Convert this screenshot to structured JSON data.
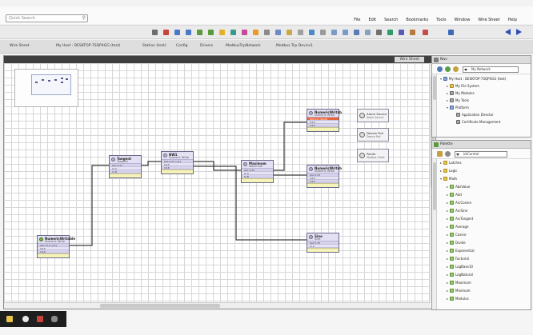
{
  "menubar": {
    "search_placeholder": "Quick Search",
    "items": [
      "File",
      "Edit",
      "Search",
      "Bookmarks",
      "Tools",
      "Window",
      "Wire Sheet",
      "Help"
    ]
  },
  "tabs": {
    "breadcrumb_items": [
      "My Host : DESKTOP-7SQP4GG (test)",
      "Station (test)",
      "Config",
      "Drivers",
      "ModbusTcpNetwork",
      "Modbus Tcp Device1"
    ],
    "view_label": "Wire Sheet"
  },
  "editor": {
    "canvas_label": "Wire Sheet"
  },
  "nodes": [
    {
      "id": "numeric-writable-left",
      "title": "NumericWritable",
      "subtitle": "Numeric Write",
      "icon": "green",
      "rows": [
        "Out  37.0 {ok}",
        "In10",
        "In16"
      ],
      "fault_rows": []
    },
    {
      "id": "tangent",
      "title": "Tangent",
      "subtitle": "Tangent",
      "icon": "gray",
      "rows": [
        "Out  0.27",
        "In A",
        "In B"
      ],
      "fault_rows": []
    },
    {
      "id": "numeric-writable-mid",
      "title": "NW1",
      "subtitle": "Numeric Write",
      "icon": "gray",
      "rows": [
        "Out  0.27 {ok}",
        "In10",
        "In16"
      ],
      "fault_rows": []
    },
    {
      "id": "maximum",
      "title": "Maximum",
      "subtitle": "Maximum",
      "icon": "gray",
      "rows": [
        "Out  0.33",
        "In A",
        "In B"
      ],
      "fault_rows": []
    },
    {
      "id": "numeric-writable-top",
      "title": "NumericWritab",
      "subtitle": "Numeric Write",
      "icon": "gray",
      "rows": [
        "In10",
        "In16"
      ],
      "fault_rows": [
        "Out  0.0 {fault}"
      ]
    },
    {
      "id": "numeric-writable-right",
      "title": "NumericWritab",
      "subtitle": "Numeric Write",
      "icon": "gray",
      "rows": [
        "Out  0.33",
        "In10",
        "In16"
      ],
      "fault_rows": []
    },
    {
      "id": "sine",
      "title": "Sine",
      "subtitle": "Sine",
      "icon": "gray",
      "rows": [
        "Out  0.33",
        "In A"
      ],
      "fault_rows": []
    }
  ],
  "refs": [
    {
      "id": "alarm-source",
      "title": "Alarm Source",
      "subtitle": "Alarm Source"
    },
    {
      "id": "device-poll",
      "title": "Device Poll",
      "subtitle": "Device Poll"
    },
    {
      "id": "points",
      "title": "Points",
      "subtitle": "Modbus Client"
    }
  ],
  "nav_panel": {
    "title": "Nav",
    "selector": "My Network",
    "tree": [
      "My Host : DESKTOP-7SQP4GG (test)",
      "My File System",
      "My Modules",
      "My Tools",
      "Platform",
      "Application Director",
      "Certificate Management"
    ]
  },
  "palette_panel": {
    "title": "Palette",
    "selector": "kitControl",
    "tree": [
      "Latches",
      "Logic",
      "Math",
      "AbsValue",
      "Add",
      "ArcCosine",
      "ArcSine",
      "ArcTangent",
      "Average",
      "Cosine",
      "Divide",
      "Exponential",
      "Factorial",
      "LogBase10",
      "LogNatural",
      "Maximum",
      "Minimum",
      "Modulus"
    ]
  },
  "colors": {
    "accent": "#2f4db8",
    "node_fill": "#eeeaf8",
    "fault": "#e9633a",
    "node_foot": "#f6f3b8"
  },
  "icons": {
    "toolbar": [
      "play-icon",
      "back-icon",
      "save-icon",
      "refresh-icon",
      "gear-icon"
    ],
    "status": [
      "folder-icon",
      "browser-icon",
      "shield-icon",
      "doc-icon"
    ]
  }
}
